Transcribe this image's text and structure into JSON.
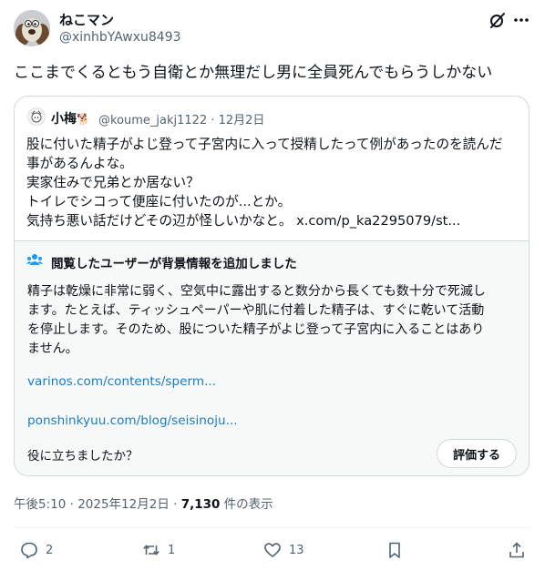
{
  "author": {
    "name": "ねこマン",
    "handle": "@xinhbYAwxu8493"
  },
  "tweet_text": "ここまでくるともう自衛とか無理だし男に全員死んでもらうしかない",
  "quote": {
    "name": "小梅",
    "handle_date": "@koume_jakj1122 · 12月2日",
    "lines": [
      "股に付いた精子がよじ登って子宮内に入って授精したって例があったのを読んだ",
      "事があるんよな。",
      "実家住みで兄弟とか居ない？",
      "トイレでシコって便座に付いたのが...とか。",
      "気持ち悪い話だけどその辺が怪しいかなと。"
    ],
    "link": "x.com/p_ka2295079/st...",
    "note": {
      "title": "閲覧したユーザーが背景情報を追加しました",
      "lines": [
        "精子は乾燥に非常に弱く、空気中に露出すると数分から長くても数十分で死滅し",
        "ます。たとえば、ティッシュペーパーや肌に付着した精子は、すぐに乾いて活動",
        "を停止します。そのため、股についた精子がよじ登って子宮内に入ることはあり",
        "ません。"
      ],
      "url1": "varinos.com/contents/sperm...",
      "url2": "ponshinkyuu.com/blog/seisinoju...",
      "helpful_question": "役に立ちましたか？",
      "rate_label": "評価する"
    }
  },
  "meta": {
    "time_date": "午後5:10 · 2025年12月2日 · ",
    "views": "7,130",
    "views_suffix": " 件の表示"
  },
  "actions": {
    "replies": "2",
    "retweets": "1",
    "likes": "13"
  },
  "colors": {
    "link": "#1d7bbf",
    "secondary_text": "#536471",
    "border": "#cfd9de",
    "note_bg": "#f7f9f9"
  }
}
